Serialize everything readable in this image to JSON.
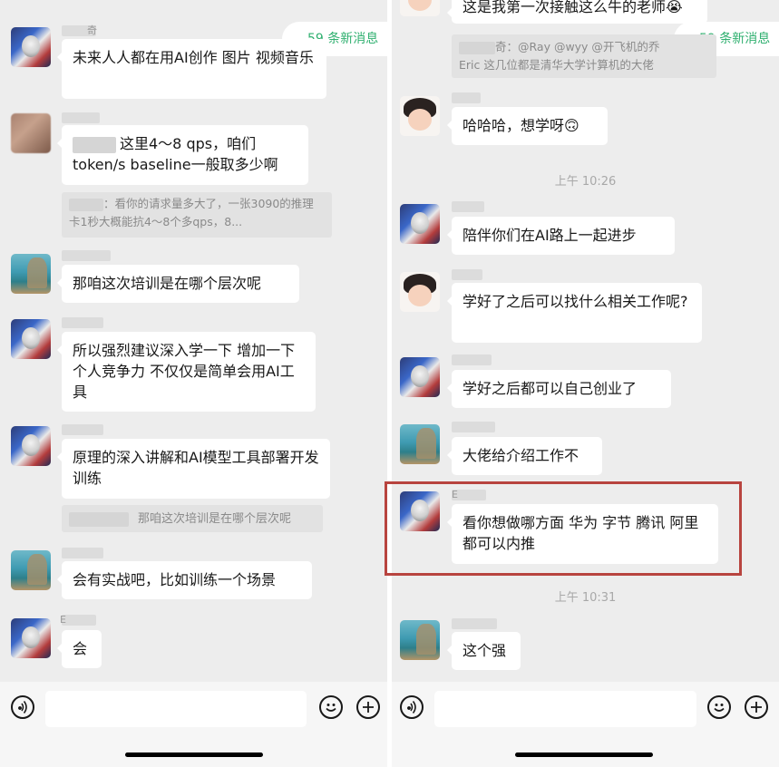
{
  "new_messages_badge": "59 条新消息",
  "left": {
    "messages": [
      {
        "avatar": "avatar-man",
        "name": "奇",
        "text": "未来人人都在用AI创作 图片 视频音乐"
      },
      {
        "avatar": "avatar-blur",
        "name": "",
        "text_parts": [
          "这里4～8 qps，咱们",
          "token/s baseline一般取多少啊"
        ],
        "quote": "：看你的请求量多大了，一张3090的推理卡1秒大概能抗4～8个多qps，8..."
      },
      {
        "avatar": "avatar-sea",
        "name": "",
        "text": "那咱这次培训是在哪个层次呢"
      },
      {
        "avatar": "avatar-man",
        "name": "",
        "text": "所以强烈建议深入学一下 增加一下个人竞争力 不仅仅是简单会用AI工具"
      },
      {
        "avatar": "avatar-man",
        "name": "",
        "text": "原理的深入讲解和AI模型工具部署开发训练",
        "quote": "那咱这次培训是在哪个层次呢"
      },
      {
        "avatar": "avatar-sea",
        "name": "",
        "text": "会有实战吧，比如训练一个场景"
      },
      {
        "avatar": "avatar-man",
        "name": "E",
        "text": "会"
      }
    ]
  },
  "right": {
    "top_text": "这是我第一次接触这么牛的老师😭",
    "top_quote_line1": "奇：@Ray @wyy @开飞机的乔",
    "top_quote_line2": "Eric 这几位都是清华大学计算机的大佬",
    "messages": [
      {
        "avatar": "avatar-cartoon",
        "text": "哈哈哈，想学呀🙃"
      },
      {
        "avatar": "avatar-man",
        "text": "陪伴你们在AI路上一起进步"
      },
      {
        "avatar": "avatar-cartoon",
        "text": "学好了之后可以找什么相关工作呢?"
      },
      {
        "avatar": "avatar-man",
        "text": "学好之后都可以自己创业了"
      },
      {
        "avatar": "avatar-sea",
        "text": "大佬给介绍工作不"
      },
      {
        "avatar": "avatar-man",
        "name": "E",
        "text": "看你想做哪方面 华为 字节 腾讯 阿里 都可以内推"
      },
      {
        "avatar": "avatar-sea",
        "text": "这个强"
      }
    ],
    "times": [
      "上午 10:26",
      "上午 10:31"
    ]
  },
  "colors": {
    "accent_green": "#30b070",
    "highlight_red": "#b8443f",
    "background": "#ededed"
  }
}
